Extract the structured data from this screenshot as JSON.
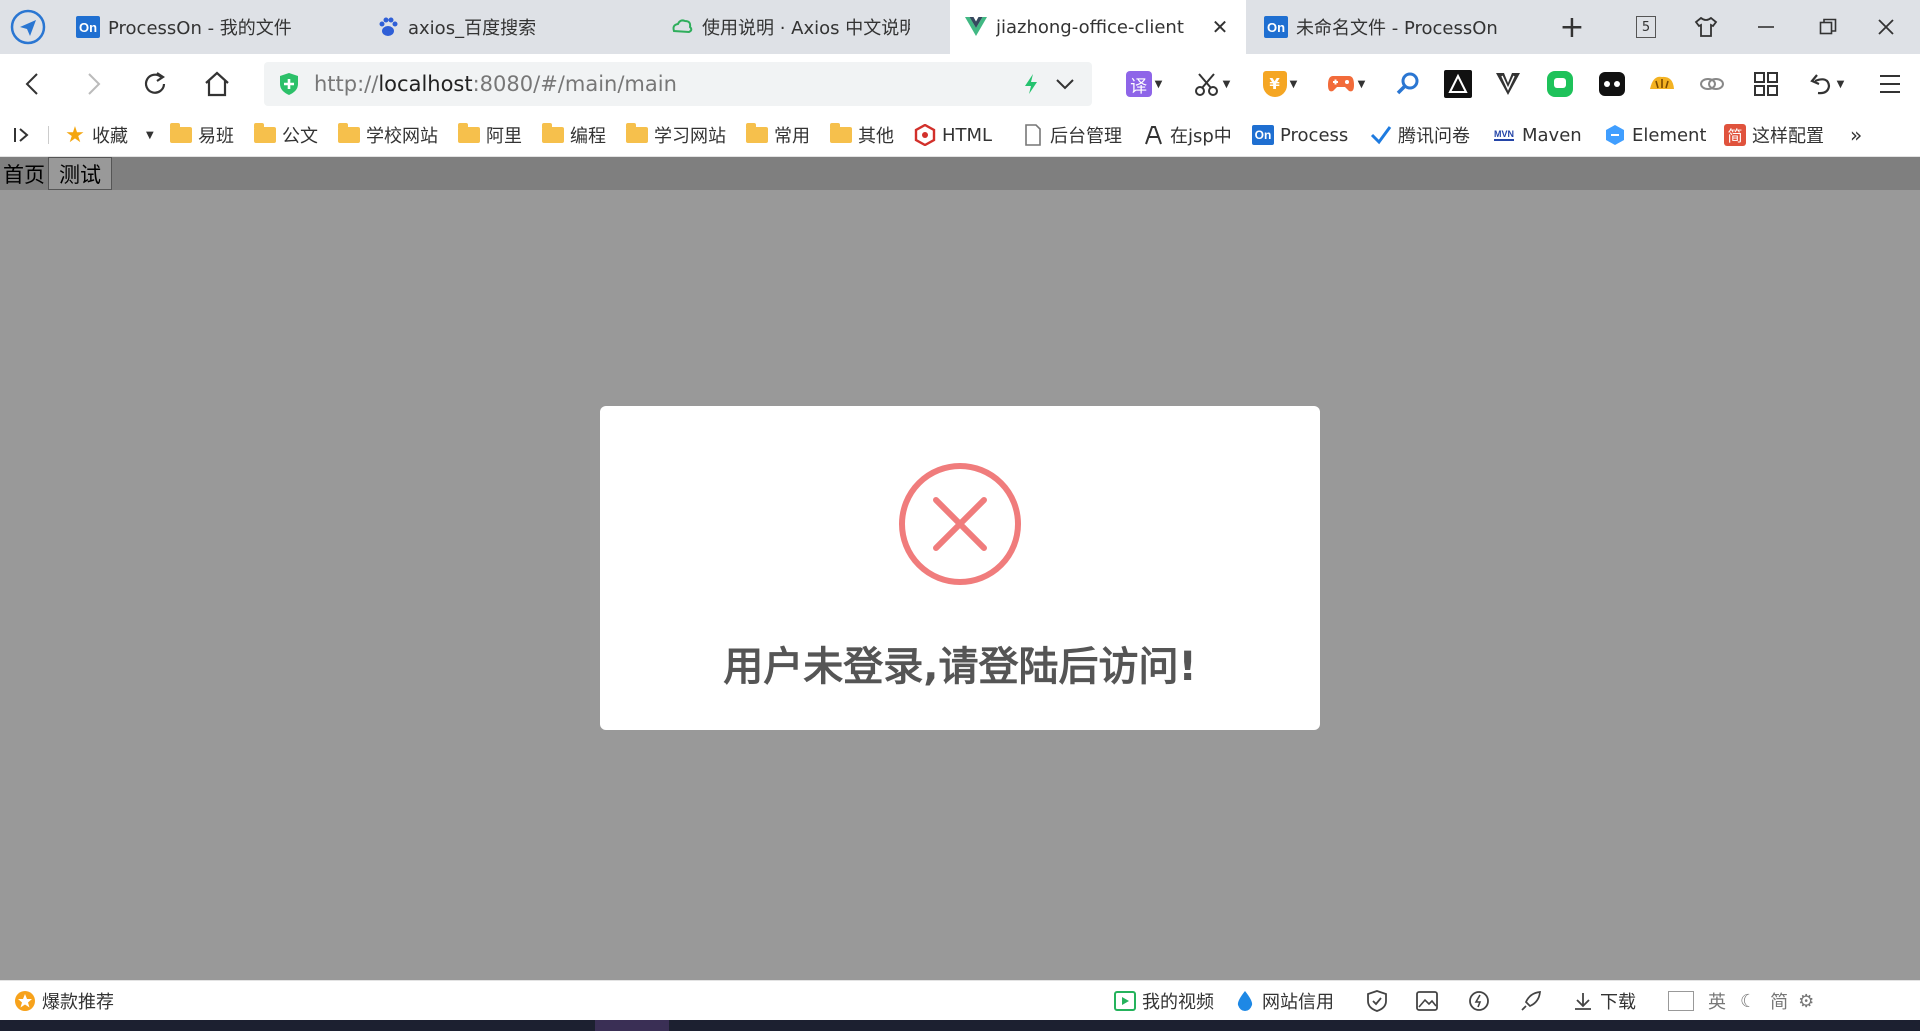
{
  "browser": {
    "tabs": [
      {
        "title": "ProcessOn - 我的文件",
        "icon": "processon-logo",
        "active": false
      },
      {
        "title": "axios_百度搜索",
        "icon": "baidu-paw-icon",
        "active": false
      },
      {
        "title": "使用说明 · Axios 中文说明",
        "icon": "axios-cloud-icon",
        "active": false
      },
      {
        "title": "jiazhong-office-client",
        "icon": "vue-logo",
        "active": true
      },
      {
        "title": "未命名文件 - ProcessOn",
        "icon": "processon-logo",
        "active": false
      }
    ],
    "processon_logo_text": "On",
    "tab_count": "5",
    "url_prefix": "http://",
    "url_host": "localhost",
    "url_rest": ":8080/#/main/main",
    "extension_translate_label": "译",
    "extension_coin_label": "¥"
  },
  "bookmarks": [
    {
      "label": "收藏",
      "icon": "star-icon"
    },
    {
      "label": "易班",
      "icon": "folder-icon"
    },
    {
      "label": "公文",
      "icon": "folder-icon"
    },
    {
      "label": "学校网站",
      "icon": "folder-icon"
    },
    {
      "label": "阿里",
      "icon": "folder-icon"
    },
    {
      "label": "编程",
      "icon": "folder-icon"
    },
    {
      "label": "学习网站",
      "icon": "folder-icon"
    },
    {
      "label": "常用",
      "icon": "folder-icon"
    },
    {
      "label": "其他",
      "icon": "folder-icon"
    },
    {
      "label": "HTML",
      "icon": "html-icon"
    },
    {
      "label": "后台管理",
      "icon": "page-icon"
    },
    {
      "label": "在jsp中",
      "icon": "link-icon"
    },
    {
      "label": "Process",
      "icon": "processon-logo"
    },
    {
      "label": "腾讯问卷",
      "icon": "check-icon"
    },
    {
      "label": "Maven",
      "icon": "maven-icon"
    },
    {
      "label": "Element",
      "icon": "element-icon"
    },
    {
      "label": "这样配置",
      "icon": "jianshu-icon"
    }
  ],
  "bookmark_overflow": "»",
  "maven_logo_text": "MVN",
  "jianshu_logo_text": "简",
  "app": {
    "nav": [
      {
        "label": "首页",
        "selected": false
      },
      {
        "label": "测试",
        "selected": true
      }
    ],
    "dialog": {
      "message": "用户未登录,请登陆后访问!",
      "icon": "error-circle-icon",
      "icon_color": "#f07c7c"
    }
  },
  "statusbar": {
    "left": {
      "label": "爆款推荐",
      "icon": "hot-badge-icon"
    },
    "right": [
      {
        "label": "我的视频",
        "icon": "video-icon"
      },
      {
        "label": "网站信用",
        "icon": "drop-icon"
      }
    ],
    "download_label": "下载",
    "ime_label": "英",
    "mode_label": "简"
  }
}
